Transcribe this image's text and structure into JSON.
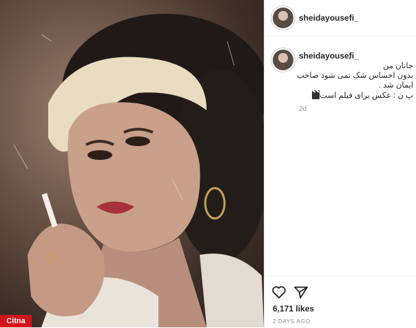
{
  "post": {
    "username": "sheidayousefi_",
    "caption_comma": ",",
    "caption_lines": [
      "جانان من",
      "بدون احساس شک نمی شود صاحب",
      "ایمان شد .",
      "پ ن : عکس برای فیلم است"
    ],
    "caption_emoji": "clapper-board-icon",
    "comment_time": "2d",
    "likes": "6,171 likes",
    "time_ago": "2 DAYS AGO"
  },
  "watermark": {
    "text": "Citna",
    "color": "#d4141c"
  }
}
